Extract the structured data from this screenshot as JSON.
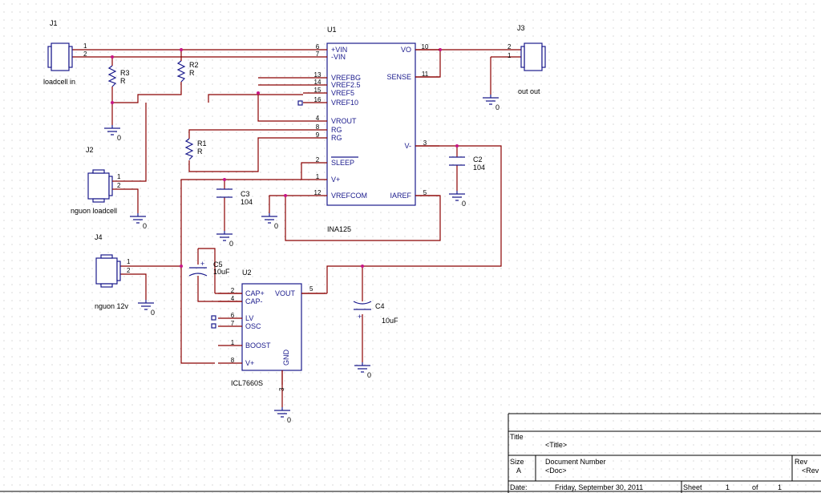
{
  "connectors": {
    "J1": {
      "ref": "J1",
      "label": "loadcell in",
      "pins": [
        "1",
        "2"
      ]
    },
    "J2": {
      "ref": "J2",
      "label": "nguon loadcell",
      "pins": [
        "1",
        "2"
      ]
    },
    "J3": {
      "ref": "J3",
      "label": "out out",
      "pins": [
        "2",
        "1"
      ]
    },
    "J4": {
      "ref": "J4",
      "label": "nguon 12v",
      "pins": [
        "1",
        "2"
      ]
    }
  },
  "u1": {
    "ref": "U1",
    "part": "INA125",
    "left_pins": [
      {
        "num": "6",
        "name": "+VIN"
      },
      {
        "num": "7",
        "name": "-VIN"
      },
      {
        "num": "13",
        "name": "VREFBG"
      },
      {
        "num": "14",
        "name": "VREF2.5"
      },
      {
        "num": "15",
        "name": "VREF5"
      },
      {
        "num": "16",
        "name": "VREF10"
      },
      {
        "num": "4",
        "name": "VROUT"
      },
      {
        "num": "8",
        "name": "RG"
      },
      {
        "num": "9",
        "name": "RG"
      },
      {
        "num": "2",
        "name": "SLEEP"
      },
      {
        "num": "1",
        "name": "V+"
      },
      {
        "num": "12",
        "name": "VREFCOM"
      }
    ],
    "right_pins": [
      {
        "num": "10",
        "name": "VO"
      },
      {
        "num": "11",
        "name": "SENSE"
      },
      {
        "num": "3",
        "name": "V-"
      },
      {
        "num": "5",
        "name": "IAREF"
      }
    ]
  },
  "u2": {
    "ref": "U2",
    "part": "ICL7660S",
    "left_pins": [
      {
        "num": "2",
        "name": "CAP+"
      },
      {
        "num": "4",
        "name": "CAP-"
      },
      {
        "num": "6",
        "name": "LV"
      },
      {
        "num": "7",
        "name": "OSC"
      },
      {
        "num": "1",
        "name": "BOOST"
      },
      {
        "num": "8",
        "name": "V+"
      }
    ],
    "right_pin": {
      "num": "5",
      "name": "VOUT"
    },
    "bottom_pin": {
      "num": "3",
      "name": "GND"
    }
  },
  "resistors": {
    "R1": {
      "ref": "R1",
      "value": "R"
    },
    "R2": {
      "ref": "R2",
      "value": "R"
    },
    "R3": {
      "ref": "R3",
      "value": "R"
    }
  },
  "capacitors": {
    "C2": {
      "ref": "C2",
      "value": "104"
    },
    "C3": {
      "ref": "C3",
      "value": "104"
    },
    "C4": {
      "ref": "C4",
      "value": "10uF"
    },
    "C5": {
      "ref": "C5",
      "value": "10uF"
    }
  },
  "ground_label": "0",
  "title_block": {
    "title_label": "Title",
    "title_value": "<Title>",
    "size_label": "Size",
    "size_value": "A",
    "docnum_label": "Document Number",
    "docnum_value": "<Doc>",
    "rev_label": "Rev",
    "rev_value": "<Rev",
    "date_label": "Date:",
    "date_value": "Friday, September 30, 2011",
    "sheet_label": "Sheet",
    "sheet_value": "1",
    "of_label": "of",
    "of_value": "1"
  }
}
